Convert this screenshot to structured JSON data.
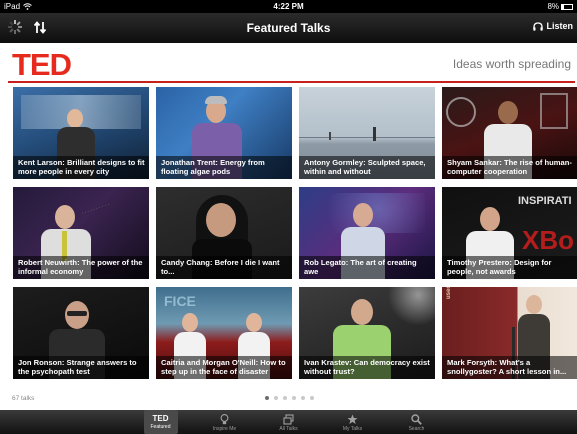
{
  "status_bar": {
    "device": "iPad",
    "time": "4:22 PM",
    "battery": "8%"
  },
  "nav": {
    "title": "Featured Talks",
    "listen_label": "Listen",
    "left_icons": [
      "loading-spinner-icon",
      "sort-arrows-icon"
    ],
    "right_icon": "headphones-icon"
  },
  "header": {
    "logo": "TED",
    "tagline": "Ideas worth spreading"
  },
  "talks": [
    {
      "caption": "Kent Larson: Brilliant designs to fit more people in every city"
    },
    {
      "caption": "Jonathan Trent: Energy from floating algae pods"
    },
    {
      "caption": "Antony Gormley: Sculpted space, within and without"
    },
    {
      "caption": "Shyam Sankar: The rise of human-computer cooperation"
    },
    {
      "caption": "Robert Neuwirth: The power of the informal economy"
    },
    {
      "caption": "Candy Chang: Before I die I want to..."
    },
    {
      "caption": "Rob Legato: The art of creating awe"
    },
    {
      "caption": "Timothy Prestero: Design for people, not awards"
    },
    {
      "caption": "Jon Ronson: Strange answers to the psychopath test"
    },
    {
      "caption": "Caitria and Morgan O'Neill: How to step up in the face of disaster"
    },
    {
      "caption": "Ivan Krastev: Can democracy exist without trust?"
    },
    {
      "caption": "Mark Forsyth: What's a snollygoster? A short lesson in..."
    }
  ],
  "footer": {
    "count": "67 talks",
    "pages": 6,
    "current_page": 1
  },
  "tab_bar": {
    "tabs": [
      {
        "icon": "ted-logo-icon",
        "label": "Featured",
        "selected": true
      },
      {
        "icon": "lightbulb-icon",
        "label": "Inspire Me",
        "selected": false
      },
      {
        "icon": "stack-icon",
        "label": "All Talks",
        "selected": false
      },
      {
        "icon": "star-icon",
        "label": "My Talks",
        "selected": false
      },
      {
        "icon": "search-icon",
        "label": "Search",
        "selected": false
      }
    ]
  },
  "colors": {
    "ted_red": "#e62b1e",
    "nav_bg": "#1a1a1a"
  }
}
